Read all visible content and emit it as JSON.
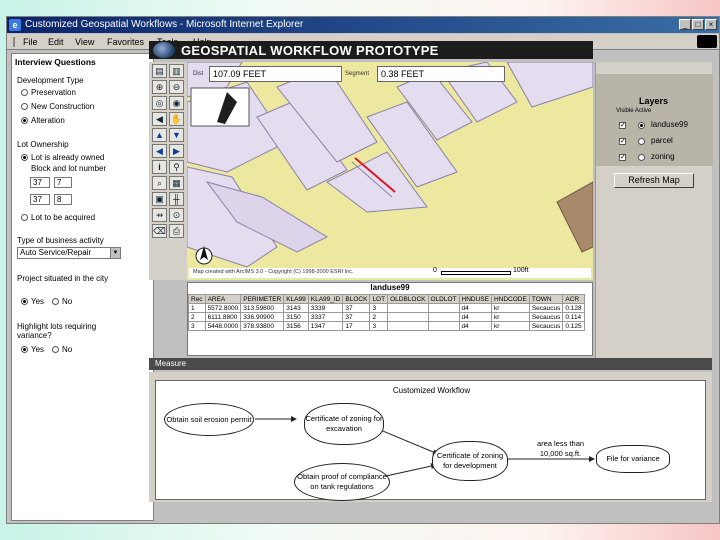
{
  "window": {
    "title": "Customized Geospatial Workflows - Microsoft Internet Explorer",
    "controls": [
      "_",
      "□",
      "×"
    ]
  },
  "menu": [
    "File",
    "Edit",
    "View",
    "Favorites",
    "Tools",
    "Help"
  ],
  "interview": {
    "title": "Interview Questions",
    "development_type": {
      "label": "Development Type",
      "options": [
        "Preservation",
        "New Construction",
        "Alteration"
      ],
      "selected": 2
    },
    "lot_ownership": {
      "label": "Lot Ownership",
      "options": [
        "Lot is already owned",
        "Lot to be acquired"
      ],
      "selected": 0,
      "block_lot_label": "Block and lot number",
      "block_lot_rows": [
        [
          "37",
          "7"
        ],
        [
          "37",
          "8"
        ]
      ]
    },
    "business_activity": {
      "label": "Type of business activity",
      "value": "Auto Service/Repair"
    },
    "project_located": {
      "label": "Project situated in the city",
      "options": [
        "Yes",
        "No"
      ],
      "selected": 0
    },
    "highlight_lots": {
      "label": "Highlight lots requiring variance?",
      "options": [
        "Yes",
        "No"
      ],
      "selected": 0
    }
  },
  "header": {
    "title": "GEOSPATIAL WORKFLOW PROTOTYPE"
  },
  "map": {
    "measure_left_label": "Dist",
    "measure_left_value": "107.09 FEET",
    "measure_right_label": "Segment",
    "measure_right_value": "0.38 FEET",
    "copyright": "Map created with ArcIMS 3.0 - Copyright (C) 1998-2000 ESRI Inc.",
    "scale_start": "0",
    "scale_end": "100ft",
    "north": "N"
  },
  "layers": {
    "title": "Layers",
    "subtitle": "Visible Active",
    "items": [
      {
        "name": "landuse99",
        "visible": true,
        "active": true
      },
      {
        "name": "parcel",
        "visible": true,
        "active": false
      },
      {
        "name": "zoning",
        "visible": true,
        "active": false
      }
    ],
    "refresh_label": "Refresh Map"
  },
  "table": {
    "title": "landuse99",
    "columns": [
      "Rec",
      "AREA",
      "PERIMETER",
      "KLA99",
      "KLA99_ID",
      "BLOCK",
      "LOT",
      "OLDBLOCK",
      "OLDLOT",
      "HNDUSE",
      "HNDCODE",
      "TOWN",
      "ACR"
    ],
    "rows": [
      [
        "1",
        "5572.8000",
        "313.59800",
        "3143",
        "3339",
        "37",
        "3",
        "",
        "",
        "d4",
        "kr",
        "Secaucus",
        "0.128"
      ],
      [
        "2",
        "6111.8800",
        "336.90900",
        "3150",
        "3337",
        "37",
        "2",
        "",
        "",
        "d4",
        "kr",
        "Secaucus",
        "0.114"
      ],
      [
        "3",
        "5448.0000",
        "378.93800",
        "3156",
        "1347",
        "17",
        "3",
        "",
        "",
        "d4",
        "kr",
        "Secaucus",
        "0.125"
      ]
    ]
  },
  "measure_bar": {
    "label": "Measure"
  },
  "workflow": {
    "title": "Customized Workflow",
    "nodes": {
      "soil": "Obtain soil erosion permit",
      "certificate_zoning": "Certificate of zoning for excavation",
      "certificate_dev": "Certificate of zoning for development",
      "compliance": "Obtain proof of compliance on tank regulations",
      "variance": "File for variance"
    },
    "edge_label": "area less than 10,000 sq.ft."
  }
}
